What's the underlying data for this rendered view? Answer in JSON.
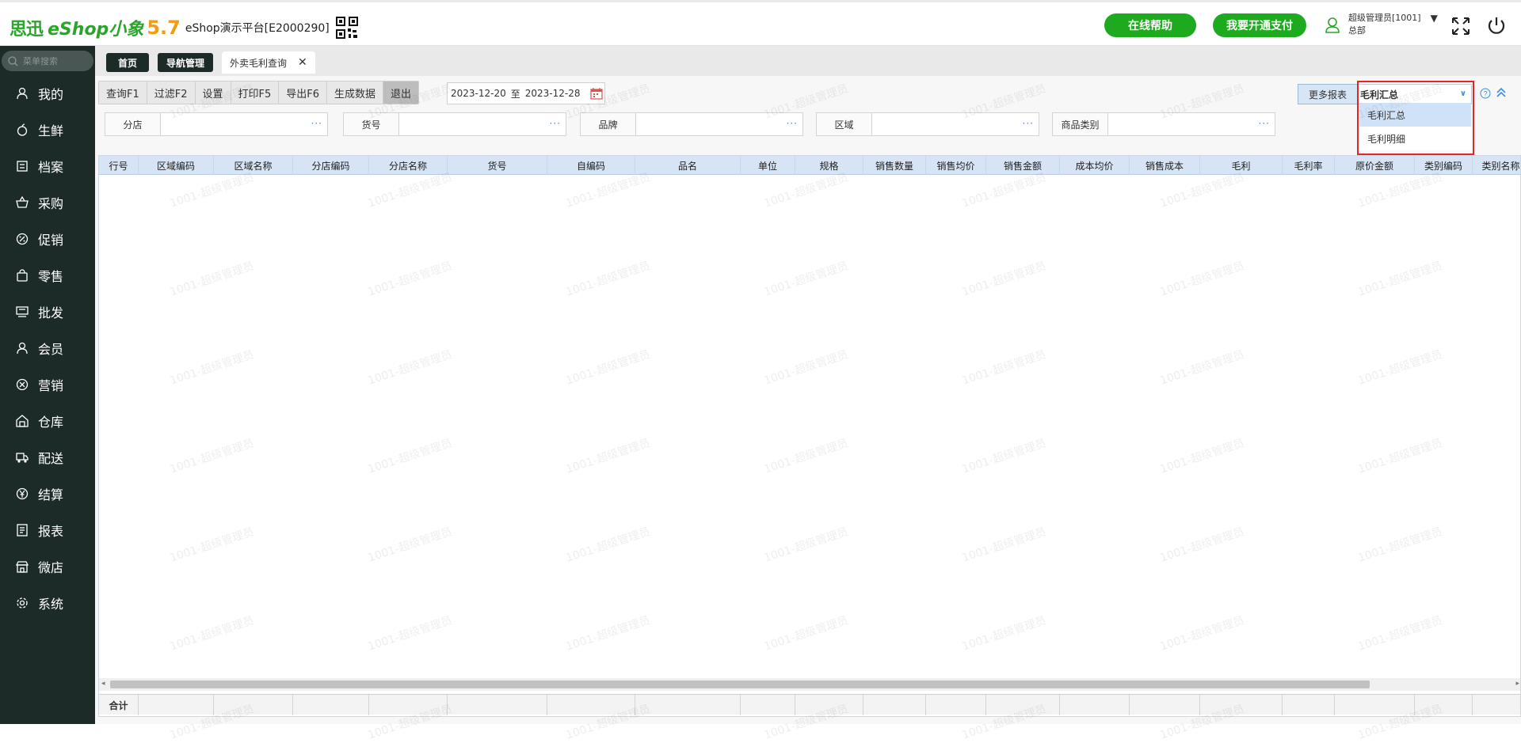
{
  "header": {
    "brand_cn": "思迅",
    "brand_eshop": "eShop小象",
    "brand_version": "5.7",
    "platform": "eShop演示平台[E2000290]",
    "help_button": "在线帮助",
    "pay_button": "我要开通支付",
    "user_name": "超级管理员[1001]",
    "user_dept": "总部",
    "user_caret": "▼"
  },
  "sidebar": {
    "search_placeholder": "菜单搜索",
    "items": [
      {
        "label": "我的",
        "icon": "user-icon"
      },
      {
        "label": "生鲜",
        "icon": "apple-icon"
      },
      {
        "label": "档案",
        "icon": "archive-icon"
      },
      {
        "label": "采购",
        "icon": "basket-icon"
      },
      {
        "label": "促销",
        "icon": "badge-icon"
      },
      {
        "label": "零售",
        "icon": "bag-icon"
      },
      {
        "label": "批发",
        "icon": "wholesale-icon"
      },
      {
        "label": "会员",
        "icon": "member-icon"
      },
      {
        "label": "营销",
        "icon": "marketing-icon"
      },
      {
        "label": "仓库",
        "icon": "warehouse-icon"
      },
      {
        "label": "配送",
        "icon": "truck-icon"
      },
      {
        "label": "结算",
        "icon": "yen-icon"
      },
      {
        "label": "报表",
        "icon": "report-icon"
      },
      {
        "label": "微店",
        "icon": "store-icon"
      },
      {
        "label": "系统",
        "icon": "gear-icon"
      }
    ]
  },
  "tabs": {
    "home": "首页",
    "nav": "导航管理",
    "active": "外卖毛利查询",
    "close": "✕"
  },
  "toolbar": {
    "buttons": [
      "查询F1",
      "过滤F2",
      "设置",
      "打印F5",
      "导出F6",
      "生成数据",
      "退出"
    ],
    "date_from": "2023-12-20",
    "date_sep": "至",
    "date_to": "2023-12-28",
    "more_reports": "更多报表",
    "report_selected": "毛利汇总",
    "dropdown_options": [
      "毛利汇总",
      "毛利明细"
    ]
  },
  "filters": [
    {
      "label": "分店",
      "value": ""
    },
    {
      "label": "货号",
      "value": ""
    },
    {
      "label": "品牌",
      "value": ""
    },
    {
      "label": "区域",
      "value": ""
    },
    {
      "label": "商品类别",
      "value": ""
    }
  ],
  "filter_dots": "···",
  "grid": {
    "columns": [
      "行号",
      "区域编码",
      "区域名称",
      "分店编码",
      "分店名称",
      "货号",
      "自编码",
      "品名",
      "单位",
      "规格",
      "销售数量",
      "销售均价",
      "销售金额",
      "成本均价",
      "销售成本",
      "毛利",
      "毛利率",
      "原价金额",
      "类别编码",
      "类别名称"
    ],
    "total_label": "合计",
    "scroll_left": "◂",
    "scroll_right": "▸"
  },
  "watermark_text": "1001-超级管理员"
}
